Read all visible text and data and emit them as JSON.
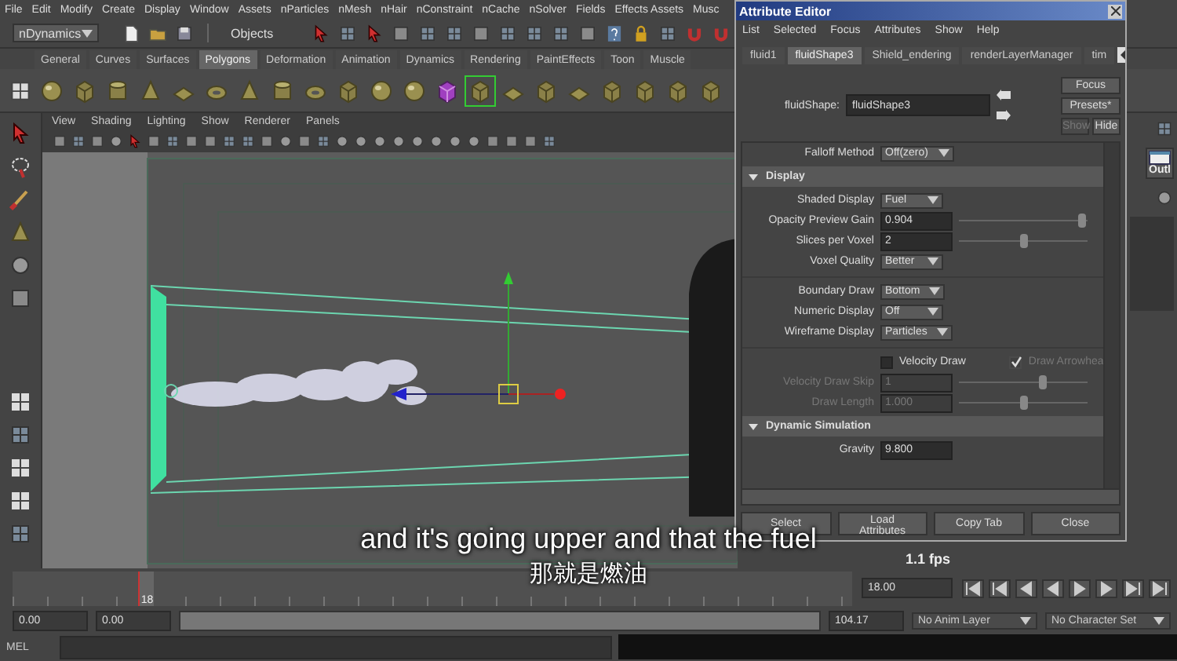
{
  "main_menu": [
    "File",
    "Edit",
    "Modify",
    "Create",
    "Display",
    "Window",
    "Assets",
    "nParticles",
    "nMesh",
    "nHair",
    "nConstraint",
    "nCache",
    "nSolver",
    "Fields",
    "Effects Assets",
    "Musc"
  ],
  "status_line": {
    "menu_set": "nDynamics",
    "selection_mode": "Objects"
  },
  "shelf": {
    "tabs": [
      {
        "label": "General",
        "selected": false
      },
      {
        "label": "Curves",
        "selected": false
      },
      {
        "label": "Surfaces",
        "selected": false
      },
      {
        "label": "Polygons",
        "selected": true
      },
      {
        "label": "Deformation",
        "selected": false
      },
      {
        "label": "Animation",
        "selected": false
      },
      {
        "label": "Dynamics",
        "selected": false
      },
      {
        "label": "Rendering",
        "selected": false
      },
      {
        "label": "PaintEffects",
        "selected": false
      },
      {
        "label": "Toon",
        "selected": false
      },
      {
        "label": "Muscle",
        "selected": false
      }
    ]
  },
  "viewport": {
    "menu": [
      "View",
      "Shading",
      "Lighting",
      "Show",
      "Renderer",
      "Panels"
    ],
    "hud_fps": "1.1 fps"
  },
  "side_panel": {
    "outliner_label": "Outl"
  },
  "attribute_editor": {
    "title": "Attribute Editor",
    "menu": [
      "List",
      "Selected",
      "Focus",
      "Attributes",
      "Show",
      "Help"
    ],
    "tabs": [
      {
        "label": "fluid1",
        "selected": false
      },
      {
        "label": "fluidShape3",
        "selected": true
      },
      {
        "label": "Shield_endering",
        "selected": false
      },
      {
        "label": "renderLayerManager",
        "selected": false
      },
      {
        "label": "tim",
        "selected": false
      }
    ],
    "node": {
      "label": "fluidShape:",
      "value": "fluidShape3"
    },
    "side_buttons": [
      {
        "label": "Focus",
        "disabled": false
      },
      {
        "label": "Presets*",
        "disabled": false
      },
      {
        "label": "Show",
        "disabled": true
      },
      {
        "label": "Hide",
        "disabled": false
      }
    ],
    "rows": [
      {
        "kind": "enum",
        "label": "Falloff Method",
        "value": "Off(zero)",
        "disabled": false
      },
      {
        "kind": "section",
        "label": "Display",
        "expanded": true
      },
      {
        "kind": "enum",
        "label": "Shaded Display",
        "value": "Fuel",
        "disabled": false
      },
      {
        "kind": "float",
        "label": "Opacity Preview Gain",
        "value": "0.904",
        "level": 0.95,
        "disabled": false
      },
      {
        "kind": "float",
        "label": "Slices per Voxel",
        "value": "2",
        "level": 0.5,
        "disabled": false
      },
      {
        "kind": "enum",
        "label": "Voxel Quality",
        "value": "Better",
        "disabled": false
      },
      {
        "kind": "divider"
      },
      {
        "kind": "enum",
        "label": "Boundary Draw",
        "value": "Bottom",
        "disabled": false
      },
      {
        "kind": "enum",
        "label": "Numeric Display",
        "value": "Off",
        "disabled": false
      },
      {
        "kind": "enum",
        "label": "Wireframe Display",
        "value": "Particles",
        "disabled": false
      },
      {
        "kind": "divider"
      },
      {
        "kind": "checks",
        "items": [
          {
            "label": "Velocity Draw",
            "checked": false,
            "disabled": false
          },
          {
            "label": "Draw Arrowhea",
            "checked": true,
            "disabled": true
          }
        ]
      },
      {
        "kind": "float",
        "label": "Velocity Draw Skip",
        "value": "1",
        "level": 0.65,
        "disabled": true
      },
      {
        "kind": "float",
        "label": "Draw Length",
        "value": "1.000",
        "level": 0.5,
        "disabled": true
      },
      {
        "kind": "section",
        "label": "Dynamic Simulation",
        "expanded": true
      },
      {
        "kind": "float",
        "label": "Gravity",
        "value": "9.800",
        "disabled": false
      }
    ],
    "buttons": [
      "Select",
      "Load Attributes",
      "Copy Tab",
      "Close"
    ]
  },
  "time_slider": {
    "current_frame": "18",
    "level": 0.15,
    "current_time": "18.00"
  },
  "range_slider": {
    "level": 1,
    "start_time": "0.00",
    "playback_start": "0.00",
    "playback_end": "104.17",
    "anim_layer": "No Anim Layer",
    "character_set": "No Character Set"
  },
  "command_line": {
    "label": "MEL"
  },
  "subtitles": [
    "and it's going upper and that the fuel",
    "那就是燃油"
  ]
}
